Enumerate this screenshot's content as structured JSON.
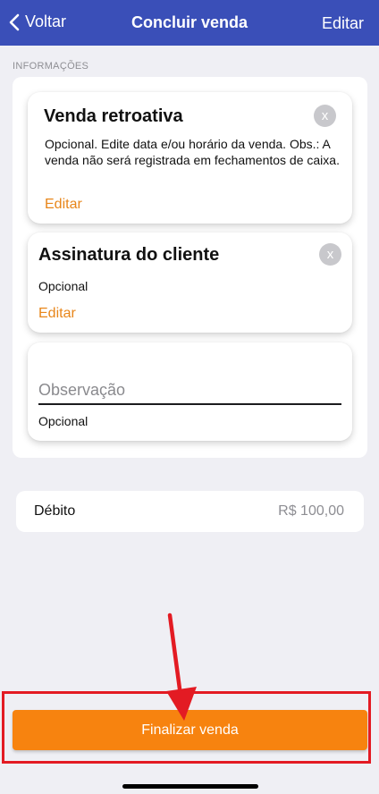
{
  "navbar": {
    "back_label": "Voltar",
    "title": "Concluir venda",
    "edit_label": "Editar"
  },
  "section": {
    "header": "INFORMAÇÕES"
  },
  "retroactive_card": {
    "title": "Venda retroativa",
    "description": "Opcional. Edite data e/ou horário da venda. Obs.: A venda não será registrada em fechamentos de caixa.",
    "link": "Editar",
    "close_icon": "x"
  },
  "signature_card": {
    "title": "Assinatura do cliente",
    "description": "Opcional",
    "link": "Editar",
    "close_icon": "x"
  },
  "observation_card": {
    "placeholder": "Observação",
    "hint": "Opcional"
  },
  "payment": {
    "method": "Débito",
    "amount": "R$ 100,00"
  },
  "finalize_button": "Finalizar venda",
  "colors": {
    "navbar": "#3a4fb8",
    "accent": "#f7830f",
    "link": "#e8861a",
    "annotation": "#e31b23"
  }
}
